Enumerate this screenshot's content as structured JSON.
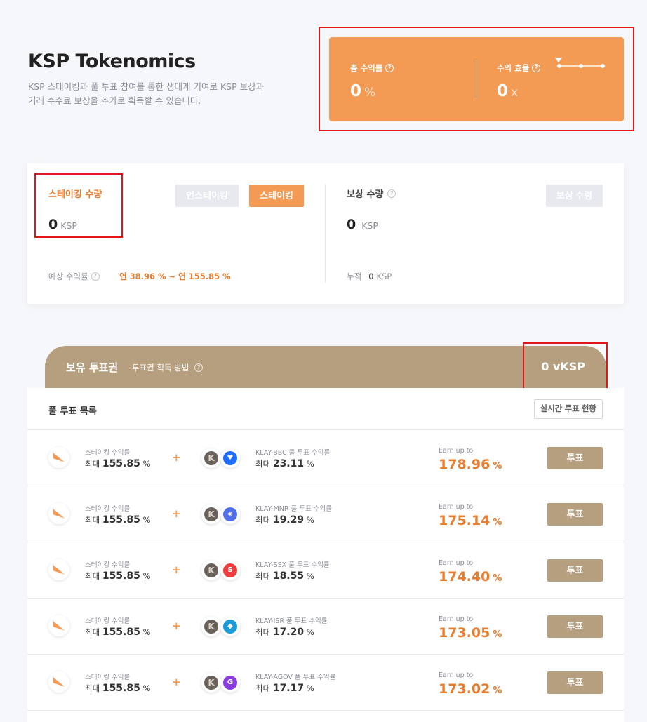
{
  "hero": {
    "title": "KSP Tokenomics",
    "desc_line1": "KSP 스테이킹과 풀 투표 참여를 통한 생태계 기여로 KSP 보상과",
    "desc_line2": "거래 수수료 보상을 추가로 획득할 수 있습니다."
  },
  "yield": {
    "total_label": "총 수익률",
    "total_value": "0",
    "total_unit": "%",
    "efficiency_label": "수익 효율",
    "efficiency_value": "0",
    "efficiency_unit": "x"
  },
  "staking": {
    "amount_label": "스테이킹 수량",
    "amount_value": "0",
    "amount_unit": "KSP",
    "unstake_label": "언스테이킹",
    "stake_label": "스테이킹",
    "apr_label": "예상 수익률",
    "apr_value": "연 38.96 % ~ 연 155.85 %",
    "reward_label": "보상 수량",
    "reward_value": "0",
    "reward_unit": "KSP",
    "claim_label": "보상 수령",
    "cumulative_label": "누적",
    "cumulative_value": "0",
    "cumulative_unit": "KSP"
  },
  "vote": {
    "title": "보유 투표권",
    "how_label": "투표권 획득 방법",
    "value": "0 vKSP",
    "list_title": "풀 투표 목록",
    "realtime_label": "실시간 투표 현황",
    "earn_label": "Earn up to",
    "vote_label": "투표",
    "staking_apr_label": "스테이킹 수익률",
    "max_prefix": "최대",
    "rows": [
      {
        "pool_label": "KLAY-BBC 풀 투표 수익률",
        "staking_max": "155.85",
        "pool_max": "23.11",
        "earn": "178.96",
        "token_color": "#1e6bff",
        "token_glyph": "♥",
        "token_icon": "bbc-token-icon"
      },
      {
        "pool_label": "KLAY-MNR 풀 투표 수익률",
        "staking_max": "155.85",
        "pool_max": "19.29",
        "earn": "175.14",
        "token_color": "#4f6fe8",
        "token_glyph": "◈",
        "token_icon": "mnr-token-icon"
      },
      {
        "pool_label": "KLAY-SSX 풀 투표 수익률",
        "staking_max": "155.85",
        "pool_max": "18.55",
        "earn": "174.40",
        "token_color": "#ef3b3b",
        "token_glyph": "S",
        "token_icon": "ssx-token-icon"
      },
      {
        "pool_label": "KLAY-ISR 풀 투표 수익률",
        "staking_max": "155.85",
        "pool_max": "17.20",
        "earn": "173.05",
        "token_color": "#1c9ad6",
        "token_glyph": "◆",
        "token_icon": "isr-token-icon"
      },
      {
        "pool_label": "KLAY-AGOV 풀 투표 수익률",
        "staking_max": "155.85",
        "pool_max": "17.17",
        "earn": "173.02",
        "token_color": "#8a3ce0",
        "token_glyph": "G",
        "token_icon": "agov-token-icon"
      }
    ],
    "percent_unit": "%"
  }
}
